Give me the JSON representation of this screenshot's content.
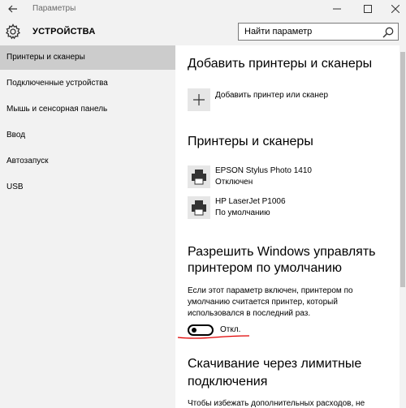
{
  "window": {
    "title": "Параметры",
    "icons": [
      "back-arrow-icon",
      "minimize-icon",
      "maximize-icon",
      "close-icon"
    ]
  },
  "header": {
    "section_title": "УСТРОЙСТВА",
    "search_placeholder": "Найти параметр",
    "icon": "gear-icon"
  },
  "sidebar": {
    "items": [
      {
        "label": "Принтеры и сканеры",
        "active": true
      },
      {
        "label": "Подключенные устройства",
        "active": false
      },
      {
        "label": "Мышь и сенсорная панель",
        "active": false
      },
      {
        "label": "Ввод",
        "active": false
      },
      {
        "label": "Автозапуск",
        "active": false
      },
      {
        "label": "USB",
        "active": false
      }
    ]
  },
  "main": {
    "add_heading": "Добавить принтеры и сканеры",
    "add_label": "Добавить принтер или сканер",
    "printers_heading": "Принтеры и сканеры",
    "printers": [
      {
        "name": "EPSON Stylus Photo 1410",
        "status": "Отключен"
      },
      {
        "name": "HP LaserJet P1006",
        "status": "По умолчанию"
      }
    ],
    "default_heading_line1": "Разрешить Windows управлять",
    "default_heading_line2": "принтером по умолчанию",
    "default_description": "Если этот параметр включен, принтером по умолчанию считается принтер, который использовался в последний раз.",
    "toggle_state": "Откл.",
    "metered_heading_line1": "Скачивание через лимитные",
    "metered_heading_line2": "подключения",
    "metered_description_partial": "Чтобы избежать дополнительных расходов, не"
  },
  "colors": {
    "sidebar_bg": "#f2f2f2",
    "active_item_bg": "#cccccc",
    "annotation_underline": "#e00000"
  }
}
